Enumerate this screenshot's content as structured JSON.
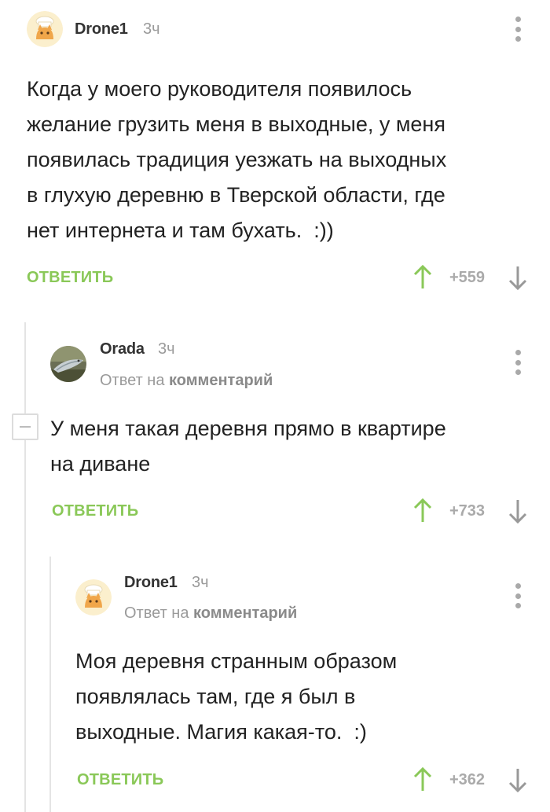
{
  "comments": [
    {
      "author": "Drone1",
      "time": "3ч",
      "reply_prefix": "",
      "reply_link": "",
      "text": "Когда у моего руководителя появилось\nжелание грузить меня в выходные, у меня\nпоявилась традиция уезжать на выходных\nв глухую деревню в Тверской области, где\nнет интернета и там бухать.  :))",
      "reply_label": "ОТВЕТИТЬ",
      "score": "+559"
    },
    {
      "author": "Orada",
      "time": "3ч",
      "reply_prefix": "Ответ на",
      "reply_link": "комментарий",
      "text": "У меня такая деревня прямо в квартире\nна диване",
      "reply_label": "ОТВЕТИТЬ",
      "score": "+733"
    },
    {
      "author": "Drone1",
      "time": "3ч",
      "reply_prefix": "Ответ на",
      "reply_link": "комментарий",
      "text": "Моя деревня странным образом\nпоявлялась там, где я был в\nвыходные. Магия какая-то.  :)",
      "reply_label": "ОТВЕТИТЬ",
      "score": "+362"
    }
  ],
  "icons": {
    "upvote": "arrow-up-icon",
    "downvote": "arrow-down-icon",
    "menu": "more-vertical-icon",
    "collapse": "minus-icon"
  },
  "colors": {
    "accent_green": "#8ac858",
    "muted_gray": "#9a9a9a",
    "thread_line": "#e4e4e4"
  }
}
